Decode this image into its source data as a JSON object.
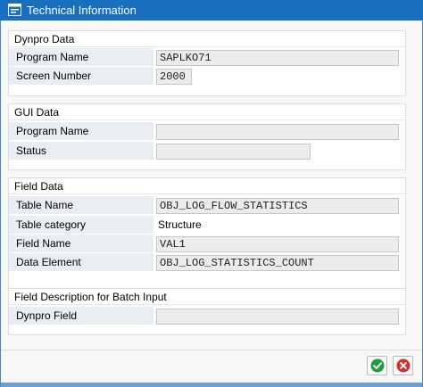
{
  "window": {
    "title": "Technical Information",
    "icon": "technical-info-icon"
  },
  "dynpro_data": {
    "header": "Dynpro Data",
    "program_name_label": "Program Name",
    "program_name_value": "SAPLKO71",
    "screen_number_label": "Screen Number",
    "screen_number_value": "2000"
  },
  "gui_data": {
    "header": "GUI Data",
    "program_name_label": "Program Name",
    "program_name_value": "",
    "status_label": "Status",
    "status_value": ""
  },
  "field_data": {
    "header": "Field Data",
    "table_name_label": "Table Name",
    "table_name_value": "OBJ_LOG_FLOW_STATISTICS",
    "table_category_label": "Table category",
    "table_category_value": "Structure",
    "field_name_label": "Field Name",
    "field_name_value": "VAL1",
    "data_element_label": "Data Element",
    "data_element_value": "OBJ_LOG_STATISTICS_COUNT"
  },
  "batch_input": {
    "header": "Field Description for Batch Input",
    "dynpro_field_label": "Dynpro Field",
    "dynpro_field_value": ""
  },
  "buttons": {
    "ok_icon": "checkmark-icon",
    "cancel_icon": "close-icon"
  },
  "colors": {
    "titlebar": "#1a6fbd",
    "label_bg": "#e9eef4",
    "ok_green": "#1e9e3a",
    "cancel_red": "#d32f2f"
  }
}
